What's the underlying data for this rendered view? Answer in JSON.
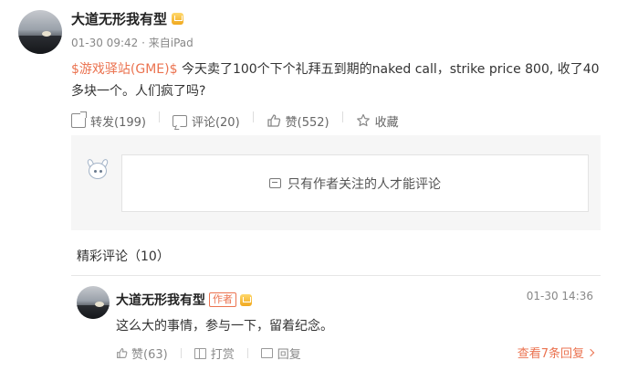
{
  "post": {
    "author": "大道无形我有型",
    "date": "01-30 09:42",
    "source": "来自iPad",
    "tag_text": "$游戏驿站(GME)$",
    "body": " 今天卖了100个下个礼拜五到期的naked call，strike price 800, 收了40多块一个。人们疯了吗?"
  },
  "actions": {
    "repost": "转发(199)",
    "comment": "评论(20)",
    "like": "赞(552)",
    "favorite": "收藏"
  },
  "comment_restriction": "只有作者关注的人才能评论",
  "featured": {
    "title": "精彩评论（10）"
  },
  "reply": {
    "author": "大道无形我有型",
    "badge": "作者",
    "time": "01-30 14:36",
    "text": "这么大的事情，参与一下，留着纪念。",
    "like": "赞(63)",
    "tip": "打赏",
    "reply_label": "回复",
    "view_replies": "查看7条回复"
  },
  "colors": {
    "accent": "#eb7350",
    "panel_bg": "#f6f6f6"
  }
}
